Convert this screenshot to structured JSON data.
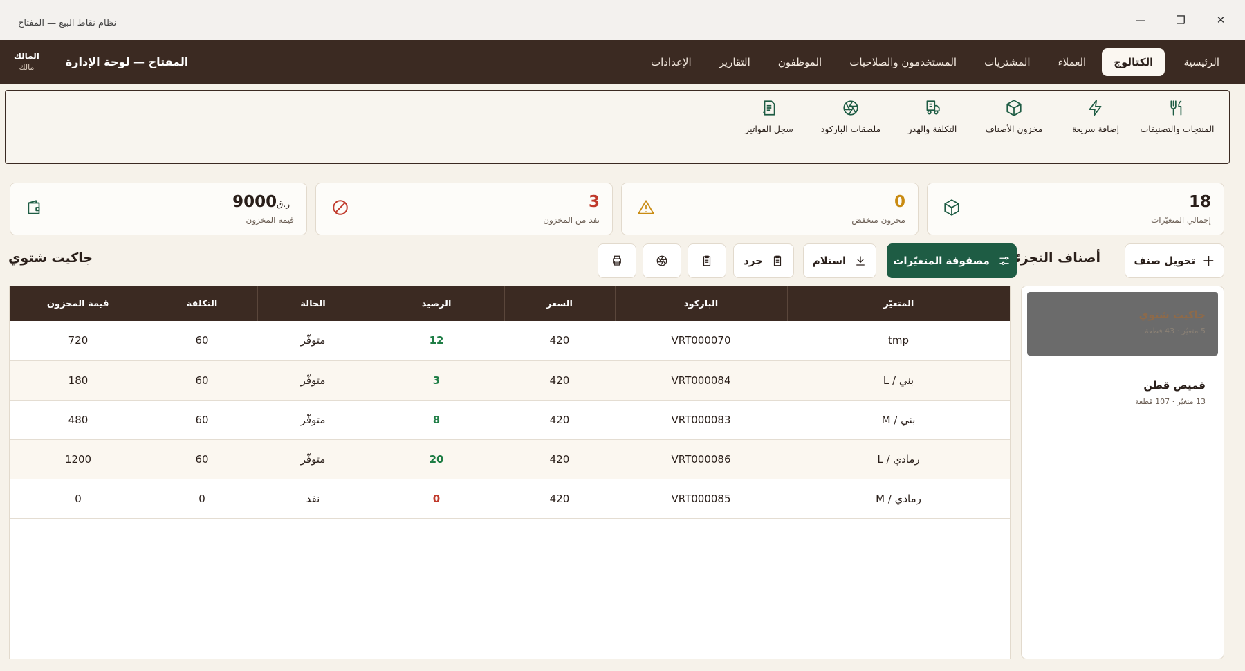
{
  "window": {
    "title": "نظام نقاط البيع — المفتاح"
  },
  "nav": {
    "tabs": [
      {
        "label": "الرئيسية",
        "active": false
      },
      {
        "label": "الكتالوج",
        "active": true
      },
      {
        "label": "العملاء",
        "active": false
      },
      {
        "label": "المشتريات",
        "active": false
      },
      {
        "label": "المستخدمون والصلاحيات",
        "active": false
      },
      {
        "label": "الموظفون",
        "active": false
      },
      {
        "label": "التقارير",
        "active": false
      },
      {
        "label": "الإعدادات",
        "active": false
      }
    ],
    "brand": "المفتاح — لوحة الإدارة",
    "user_name": "المالك",
    "user_role": "مالك"
  },
  "subnav": {
    "items": [
      {
        "label": "المنتجات والتصنيفات",
        "icon": "utensils-icon"
      },
      {
        "label": "إضافة سريعة",
        "icon": "lightning-icon"
      },
      {
        "label": "مخزون الأصناف",
        "icon": "box-icon"
      },
      {
        "label": "التكلفة والهدر",
        "icon": "receipt-truck-icon"
      },
      {
        "label": "ملصقات الباركود",
        "icon": "aperture-icon"
      },
      {
        "label": "سجل الفواتير",
        "icon": "document-icon"
      }
    ]
  },
  "stats": [
    {
      "value": "18",
      "label": "إجمالي المتغيّرات",
      "icon": "box-icon",
      "color": "#2a1f1a",
      "icon_color": "#1e5c44"
    },
    {
      "value": "0",
      "label": "مخزون منخفض",
      "icon": "warning-icon",
      "color": "#c98b12",
      "icon_color": "#c98b12"
    },
    {
      "value": "3",
      "label": "نفد من المخزون",
      "icon": "ban-icon",
      "color": "#c0392b",
      "icon_color": "#c0392b"
    },
    {
      "value": "9000",
      "currency": "ر.ق",
      "label": "قيمة المخزون",
      "icon": "wallet-icon",
      "color": "#2a1f1a",
      "icon_color": "#1e5c44"
    }
  ],
  "categories": {
    "title": "أصناف التجزئة",
    "add_label": "تحويل صنف",
    "items": [
      {
        "name": "جاكيت شتوي",
        "meta": "5 متغيّر · 43 قطعة",
        "active": true
      },
      {
        "name": "قميص قطن",
        "meta": "13 متغيّر · 107 قطعة",
        "active": false
      }
    ]
  },
  "toolbar": {
    "matrix_label": "مصفوفة المتغيّرات",
    "receive_label": "استلام",
    "count_label": "جرد"
  },
  "table": {
    "title": "جاكيت شتوي",
    "columns": [
      "المتغيّر",
      "الباركود",
      "السعر",
      "الرصيد",
      "الحالة",
      "التكلفة",
      "قيمة المخزون"
    ],
    "rows": [
      {
        "variant": "tmp",
        "barcode": "VRT000070",
        "price": "420",
        "balance": "12",
        "status": "متوفّر",
        "cost": "60",
        "value": "720",
        "balance_color": "#1e7d45"
      },
      {
        "variant": "بني / L",
        "barcode": "VRT000084",
        "price": "420",
        "balance": "3",
        "status": "متوفّر",
        "cost": "60",
        "value": "180",
        "balance_color": "#1e7d45"
      },
      {
        "variant": "بني / M",
        "barcode": "VRT000083",
        "price": "420",
        "balance": "8",
        "status": "متوفّر",
        "cost": "60",
        "value": "480",
        "balance_color": "#1e7d45"
      },
      {
        "variant": "رمادي / L",
        "barcode": "VRT000086",
        "price": "420",
        "balance": "20",
        "status": "متوفّر",
        "cost": "60",
        "value": "1200",
        "balance_color": "#1e7d45"
      },
      {
        "variant": "رمادي / M",
        "barcode": "VRT000085",
        "price": "420",
        "balance": "0",
        "status": "نفد",
        "cost": "0",
        "value": "0",
        "balance_color": "#c0392b"
      }
    ]
  }
}
